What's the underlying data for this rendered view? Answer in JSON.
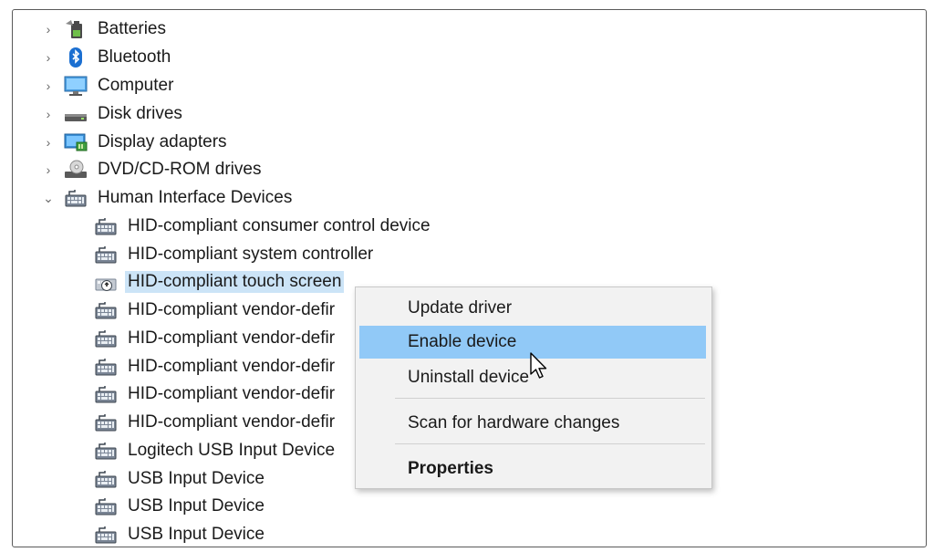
{
  "tree": {
    "categories": [
      {
        "label": "Batteries",
        "icon": "battery-icon",
        "expanded": false
      },
      {
        "label": "Bluetooth",
        "icon": "bluetooth-icon",
        "expanded": false
      },
      {
        "label": "Computer",
        "icon": "computer-icon",
        "expanded": false
      },
      {
        "label": "Disk drives",
        "icon": "disk-drive-icon",
        "expanded": false
      },
      {
        "label": "Display adapters",
        "icon": "display-adapter-icon",
        "expanded": false
      },
      {
        "label": "DVD/CD-ROM drives",
        "icon": "dvd-drive-icon",
        "expanded": false
      },
      {
        "label": "Human Interface Devices",
        "icon": "hid-icon",
        "expanded": true
      }
    ],
    "hid_children": [
      {
        "label": "HID-compliant consumer control device",
        "icon": "hid-device-icon"
      },
      {
        "label": "HID-compliant system controller",
        "icon": "hid-device-icon"
      },
      {
        "label": "HID-compliant touch screen",
        "icon": "disabled-hid-device-icon",
        "selected": true
      },
      {
        "label": "HID-compliant vendor-defir",
        "icon": "hid-device-icon"
      },
      {
        "label": "HID-compliant vendor-defir",
        "icon": "hid-device-icon"
      },
      {
        "label": "HID-compliant vendor-defir",
        "icon": "hid-device-icon"
      },
      {
        "label": "HID-compliant vendor-defir",
        "icon": "hid-device-icon"
      },
      {
        "label": "HID-compliant vendor-defir",
        "icon": "hid-device-icon"
      },
      {
        "label": "Logitech USB Input Device",
        "icon": "hid-device-icon"
      },
      {
        "label": "USB Input Device",
        "icon": "hid-device-icon"
      },
      {
        "label": "USB Input Device",
        "icon": "hid-device-icon"
      },
      {
        "label": "USB Input Device",
        "icon": "hid-device-icon"
      }
    ]
  },
  "context_menu": {
    "items": [
      {
        "label": "Update driver"
      },
      {
        "label": "Enable device",
        "highlighted": true
      },
      {
        "label": "Uninstall device"
      },
      {
        "label": "Scan for hardware changes"
      },
      {
        "label": "Properties",
        "bold": true
      }
    ]
  },
  "colors": {
    "selection": "#cce4f7",
    "menu_highlight": "#91c9f7",
    "menu_background": "#f2f2f2"
  }
}
